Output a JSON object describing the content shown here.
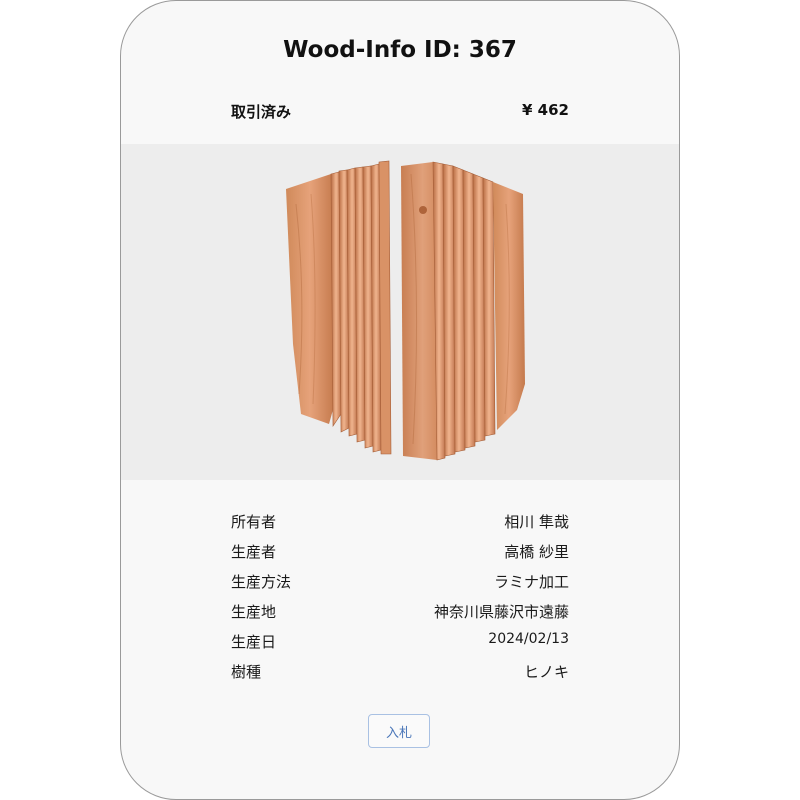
{
  "card": {
    "title": "Wood-Info ID: 367",
    "status": "取引済み",
    "price": "¥ 462"
  },
  "image": {
    "icon": "laminated-wood-block-photo",
    "background_color": "#ededed",
    "wood_color": "#d9895b"
  },
  "details": [
    {
      "label": "所有者",
      "value": "相川 隼哉"
    },
    {
      "label": "生産者",
      "value": "高橋 紗里"
    },
    {
      "label": "生産方法",
      "value": "ラミナ加工"
    },
    {
      "label": "生産地",
      "value": "神奈川県藤沢市遠藤"
    },
    {
      "label": "生産日",
      "value": "2024/02/13"
    },
    {
      "label": "樹種",
      "value": "ヒノキ"
    }
  ],
  "actions": {
    "bid_label": "入札",
    "accent_color": "#4a76b8"
  }
}
